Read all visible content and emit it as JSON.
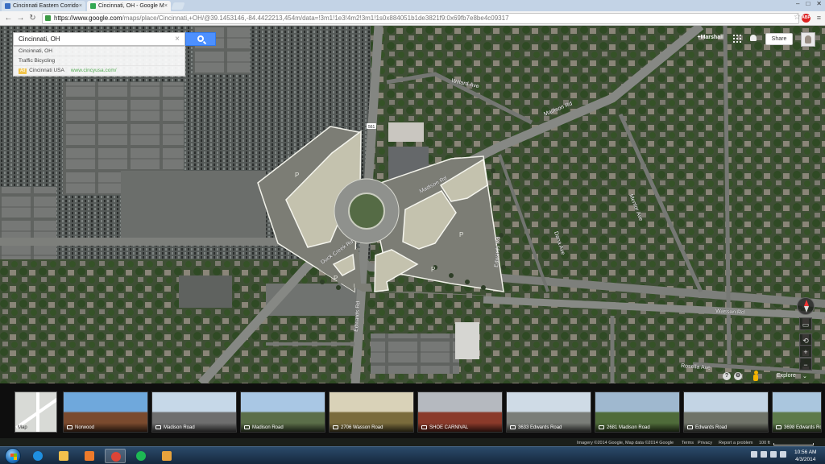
{
  "browser": {
    "tabs": [
      {
        "label": "Cincinnati Eastern Corrido",
        "favicon_color": "#3b6fc2",
        "active": false
      },
      {
        "label": "Cincinnati, OH - Google M",
        "favicon_color": "#34a853",
        "active": true
      }
    ],
    "window_controls": [
      "–",
      "□",
      "✕"
    ],
    "url_host": "https://www.google.com",
    "url_path": "/maps/place/Cincinnati,+OH/@39.1453146,-84.4422213,454m/data=!3m1!1e3!4m2!3m1!1s0x884051b1de3821f9:0x69fb7e8be4c09317",
    "adblock_label": "ABP"
  },
  "search": {
    "query": "Cincinnati, OH",
    "suggestions": {
      "place": "Cincinnati, OH",
      "layers": "Traffic   Bicycling",
      "ad_tag": "Ad",
      "ad_title": "Cincinnati USA",
      "ad_url": "www.cincyusa.com/"
    }
  },
  "account": {
    "username": "+Marshall",
    "share_label": "Share"
  },
  "map": {
    "parking_label": "P",
    "road_labels": [
      {
        "text": "Madison Rd"
      },
      {
        "text": "Madison Rd"
      },
      {
        "text": "Willard Ave"
      },
      {
        "text": "Wasson Rd"
      },
      {
        "text": "Duck Creek Rd"
      },
      {
        "text": "Edwards Rd"
      },
      {
        "text": "Edwards Rd"
      },
      {
        "text": "Dana Ave"
      },
      {
        "text": "Rosella Ave"
      },
      {
        "text": "Mentor Ave"
      }
    ],
    "shield_label": "561"
  },
  "controls": {
    "zoom_in": "+",
    "zoom_out": "−",
    "explore_label": "Explore",
    "help_label": "?"
  },
  "filmstrip": {
    "map_label": "Map",
    "photos": [
      {
        "label": "Norwood",
        "color_sky": "#6fa8dc",
        "color_ground": "#7a4a2e"
      },
      {
        "label": "Madison Road",
        "color_sky": "#c6d8e8",
        "color_ground": "#6e6e6e"
      },
      {
        "label": "Madison Road",
        "color_sky": "#a9c7e4",
        "color_ground": "#5b6e49"
      },
      {
        "label": "2706 Wasson Road",
        "color_sky": "#d9d2b8",
        "color_ground": "#7a6b3c"
      },
      {
        "label": "SHOE CARNIVAL",
        "color_sky": "#b5b9bf",
        "color_ground": "#8a3a2a"
      },
      {
        "label": "3633 Edwards Road",
        "color_sky": "#cfdbe6",
        "color_ground": "#7a7d78"
      },
      {
        "label": "2681 Madison Road",
        "color_sky": "#9fb8cf",
        "color_ground": "#4f6b3a"
      },
      {
        "label": "Edwards Road",
        "color_sky": "#c3d4e4",
        "color_ground": "#6f7368"
      },
      {
        "label": "3698 Edwards Road",
        "color_sky": "#aac6de",
        "color_ground": "#5d7a4a"
      }
    ]
  },
  "attribution": {
    "imagery": "Imagery ©2014 Google, Map data ©2014 Google",
    "terms": "Terms",
    "privacy": "Privacy",
    "report": "Report a problem",
    "scale": "100 ft"
  },
  "taskbar": {
    "time": "10:56 AM",
    "date": "4/3/2014",
    "apps": [
      {
        "name": "ie-icon",
        "color": "#1f8fe0"
      },
      {
        "name": "explorer-icon",
        "color": "#f3c04c"
      },
      {
        "name": "media-player-icon",
        "color": "#ee7b2b"
      },
      {
        "name": "chrome-icon",
        "color": "#db4437"
      },
      {
        "name": "spotify-icon",
        "color": "#1db954"
      },
      {
        "name": "outlook-icon",
        "color": "#e8a33c"
      }
    ]
  }
}
